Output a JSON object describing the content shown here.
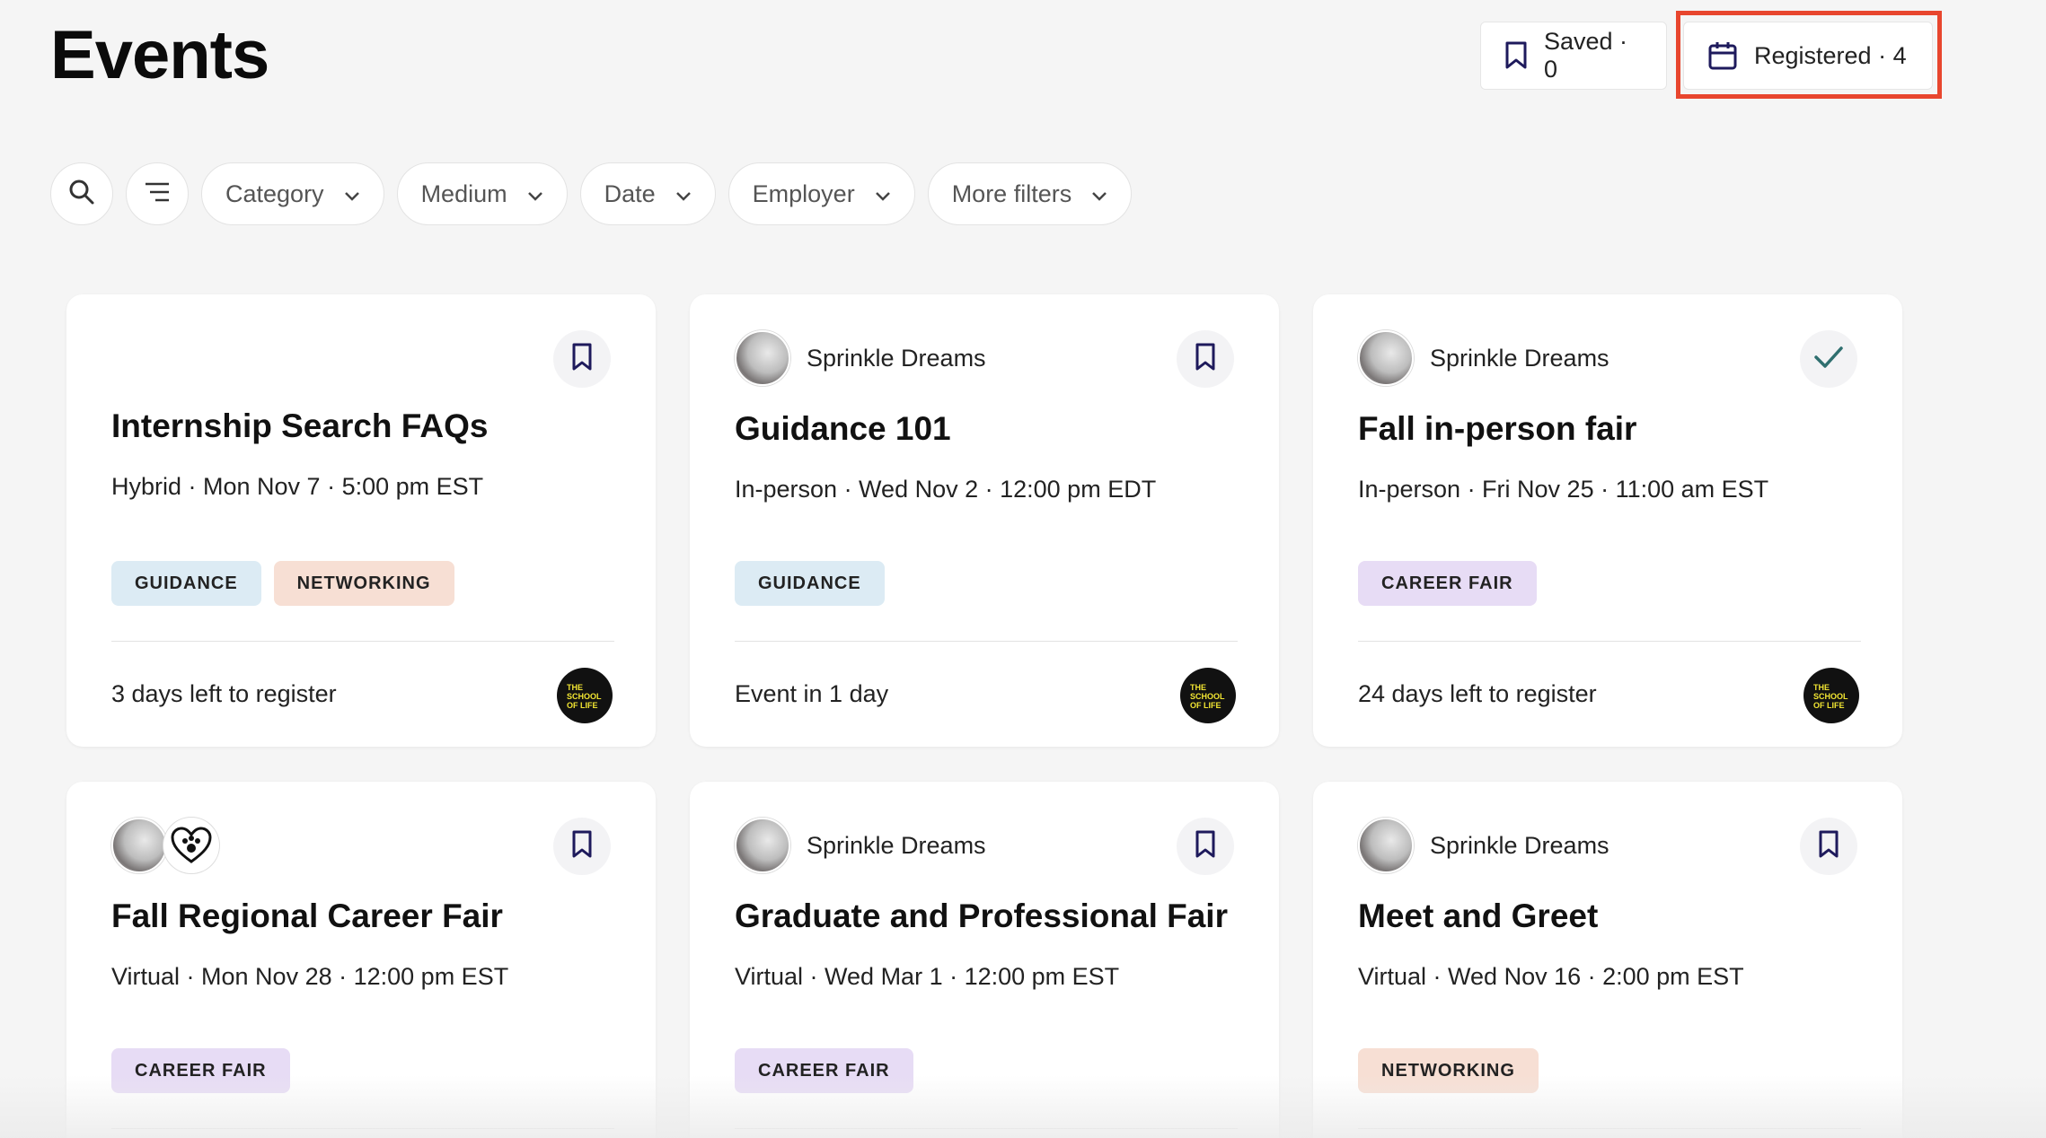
{
  "page": {
    "title": "Events"
  },
  "header": {
    "saved_label": "Saved · 0",
    "registered_label": "Registered · 4"
  },
  "filters": {
    "search_icon": "search-icon",
    "sort_icon": "sort-lines-icon",
    "pills": [
      "Category",
      "Medium",
      "Date",
      "Employer",
      "More filters"
    ]
  },
  "colors": {
    "accent": "#1e1a5c",
    "highlight_border": "#e8462e",
    "tag_guidance": "#dcebf4",
    "tag_networking": "#f7dfd4",
    "tag_career_fair": "#e7dcf5",
    "check_color": "#2f6f6f"
  },
  "events": [
    {
      "title": "Internship Search FAQs",
      "org": "",
      "meta": "Hybrid · Mon Nov 7 · 5:00 pm EST",
      "tags": [
        "GUIDANCE",
        "NETWORKING"
      ],
      "footer": "3 days left to register",
      "status_icon": "bookmark-icon"
    },
    {
      "title": "Guidance 101",
      "org": "Sprinkle Dreams",
      "meta": "In-person · Wed Nov 2 · 12:00 pm EDT",
      "tags": [
        "GUIDANCE"
      ],
      "footer": "Event in 1 day",
      "status_icon": "bookmark-icon"
    },
    {
      "title": "Fall in-person fair",
      "org": "Sprinkle Dreams",
      "meta": "In-person · Fri Nov 25 · 11:00 am EST",
      "tags": [
        "CAREER FAIR"
      ],
      "footer": "24 days left to register",
      "status_icon": "check-icon"
    },
    {
      "title": "Fall Regional Career Fair",
      "org": "",
      "meta": "Virtual · Mon Nov 28 · 12:00 pm EST",
      "tags": [
        "CAREER FAIR"
      ],
      "status_icon": "bookmark-icon"
    },
    {
      "title": "Graduate and Professional Fair",
      "org": "Sprinkle Dreams",
      "meta": "Virtual · Wed Mar 1 · 12:00 pm EST",
      "tags": [
        "CAREER FAIR"
      ],
      "status_icon": "bookmark-icon"
    },
    {
      "title": "Meet and Greet",
      "org": "Sprinkle Dreams",
      "meta": "Virtual · Wed Nov 16 · 2:00 pm EST",
      "tags": [
        "NETWORKING"
      ],
      "status_icon": "bookmark-icon"
    }
  ]
}
